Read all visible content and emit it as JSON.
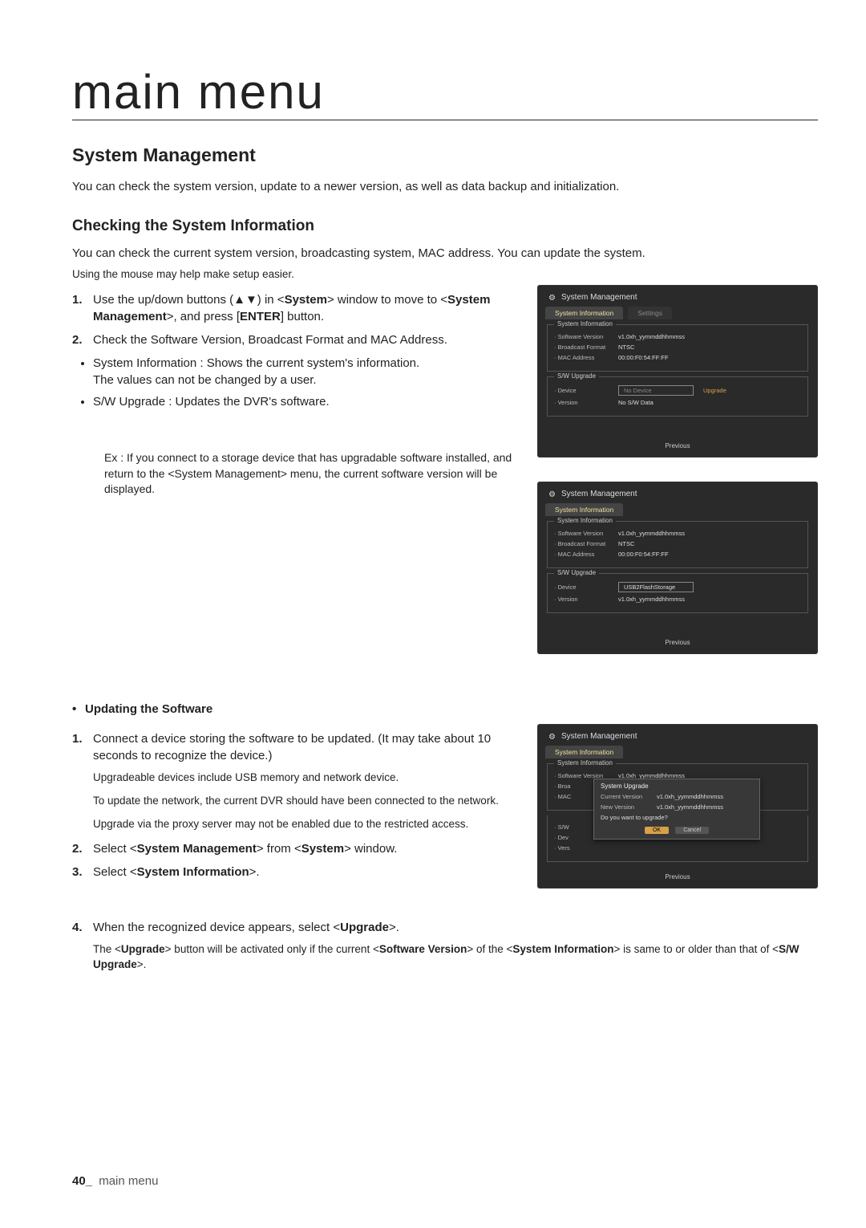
{
  "main_title": "main menu",
  "section1": {
    "heading": "System Management",
    "intro": "You can check the system version, update to a newer version, as well as data backup and initialization."
  },
  "section2": {
    "heading": "Checking the System Information",
    "intro": "You can check the current system version, broadcasting system, MAC address. You can update the system.",
    "mouse_hint": "Using the mouse may help make setup easier.",
    "step1_a": "Use the up/down buttons (▲▼) in <",
    "step1_b": "System",
    "step1_c": "> window to move to <",
    "step1_d": "System Management",
    "step1_e": ">, and press [",
    "step1_f": "ENTER",
    "step1_g": "] button.",
    "step2": "Check the Software Version, Broadcast Format and MAC Address.",
    "bullet1_a": "System Information : Shows the current system's information.",
    "bullet1_b": "The values can not be changed by a user.",
    "bullet2": "S/W Upgrade : Updates the DVR's software.",
    "example": "Ex : If you connect to a storage device that has upgradable software installed, and return to the <System Management> menu, the current software version will be displayed."
  },
  "updating": {
    "heading": "Updating the Software",
    "step1": "Connect a device storing the software to be updated. (It may take about 10 seconds to recognize the device.)",
    "sub1": "Upgradeable devices include USB memory and network device.",
    "sub2": "To update the network, the current DVR should have been connected to the network.",
    "sub3": "Upgrade via the proxy server may not be enabled due to the restricted access.",
    "step2_a": "Select <",
    "step2_b": "System Management",
    "step2_c": "> from <",
    "step2_d": "System",
    "step2_e": "> window.",
    "step3_a": "Select <",
    "step3_b": "System Information",
    "step3_c": ">.",
    "step4_a": "When the recognized device appears, select <",
    "step4_b": "Upgrade",
    "step4_c": ">.",
    "note_a": "The <",
    "note_b": "Upgrade",
    "note_c": "> button will be activated only if the current <",
    "note_d": "Software Version",
    "note_e": "> of the <",
    "note_f": "System Information",
    "note_g": "> is same to or older than that of <",
    "note_h": "S/W Upgrade",
    "note_i": ">."
  },
  "shot": {
    "title": "System Management",
    "tab_active": "System Information",
    "tab_inactive": "Settings",
    "fs1_legend": "System Information",
    "sw_version_lbl": "· Software Version",
    "sw_version_val": "v1.0xh_yymmddhhmmss",
    "broadcast_lbl": "· Broadcast Format",
    "broadcast_val": "NTSC",
    "mac_lbl": "· MAC Address",
    "mac_val": "00:00:F0:54:FF:FF",
    "fs2_legend": "S/W Upgrade",
    "device_lbl": "· Device",
    "no_device": "No Device",
    "usb_device": "USB2FlashStorage",
    "upgrade_btn": "Upgrade",
    "version_lbl": "· Version",
    "nosw": "No S/W Data",
    "ver_val": "v1.0xh_yymmddhhmmss",
    "previous": "Previous",
    "popup_title": "System Upgrade",
    "cur_ver_lbl": "Current Version",
    "new_ver_lbl": "New Version",
    "popup_q": "Do you want to upgrade?",
    "ok": "OK",
    "cancel": "Cancel"
  },
  "footer": {
    "page": "40_",
    "label": "main menu"
  }
}
